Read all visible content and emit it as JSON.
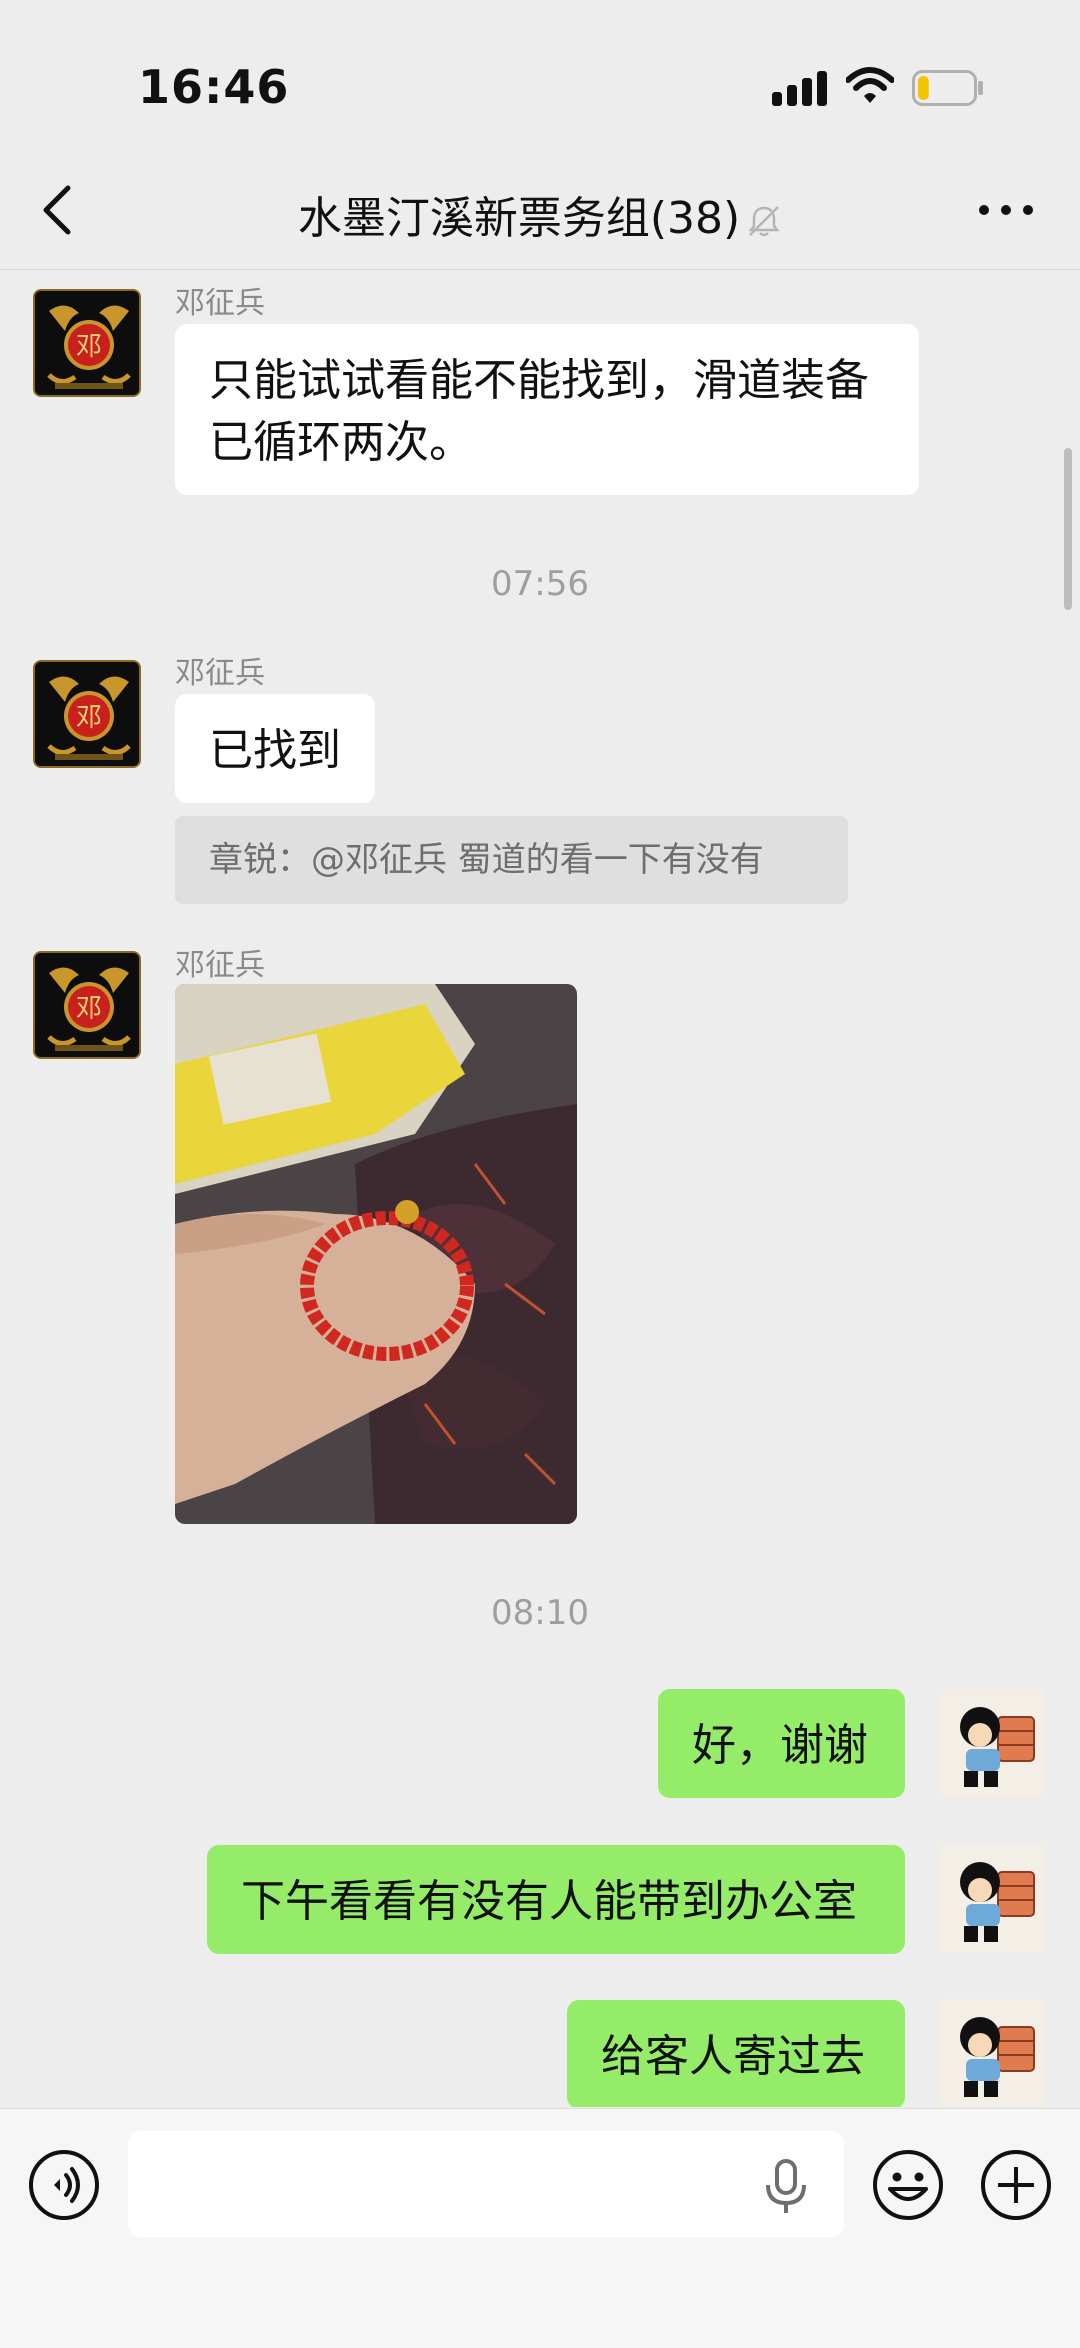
{
  "status": {
    "time": "16:46"
  },
  "header": {
    "title": "水墨汀溪新票务组(38)"
  },
  "messages": [
    {
      "sender": "邓征兵",
      "text": "只能试试看能不能找到，滑道装备已循环两次。"
    },
    {
      "timestamp": "07:56"
    },
    {
      "sender": "邓征兵",
      "text": "已找到",
      "quote": "章锐：@邓征兵 蜀道的看一下有没有"
    },
    {
      "sender": "邓征兵",
      "image": "photo-bracelet"
    },
    {
      "timestamp": "08:10"
    },
    {
      "self": true,
      "text": "好，谢谢"
    },
    {
      "self": true,
      "text": "下午看看有没有人能带到办公室"
    },
    {
      "self": true,
      "text": "给客人寄过去"
    }
  ],
  "avatars": {
    "deng_char": "邓"
  },
  "colors": {
    "background": "#ededed",
    "self_bubble": "#95ec69",
    "other_bubble": "#ffffff",
    "battery_level": "#f5c400"
  },
  "battery": {
    "level": 0.2
  }
}
